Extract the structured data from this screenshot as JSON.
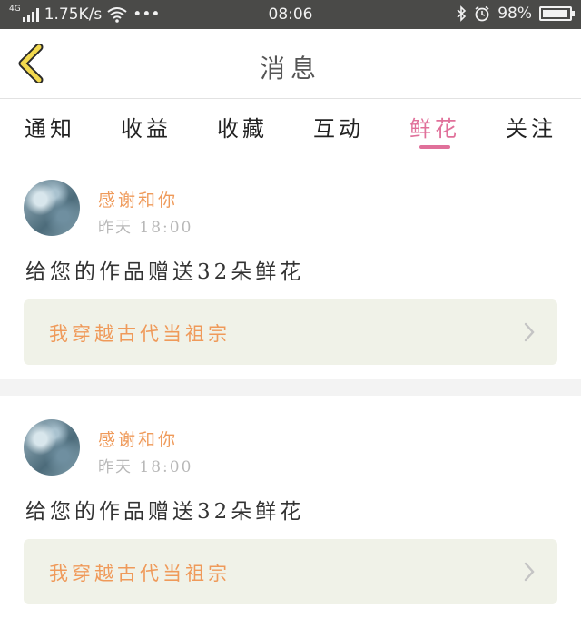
{
  "status_bar": {
    "network_type": "4G",
    "speed": "1.75K/s",
    "dots": "•••",
    "time": "08:06",
    "battery_percent": "98%",
    "battery_level": 0.98,
    "icons": [
      "signal-icon",
      "wifi-icon",
      "bluetooth-icon",
      "alarm-icon",
      "battery-icon"
    ]
  },
  "header": {
    "title": "消息",
    "back_icon": "chevron-left-icon",
    "back_icon_color": "#f2d94e"
  },
  "tabs": [
    {
      "label": "通知",
      "active": false
    },
    {
      "label": "收益",
      "active": false
    },
    {
      "label": "收藏",
      "active": false
    },
    {
      "label": "互动",
      "active": false
    },
    {
      "label": "鲜花",
      "active": true
    },
    {
      "label": "关注",
      "active": false
    }
  ],
  "colors": {
    "accent": "#e0709a",
    "sender": "#ef9a5a",
    "card_link_bg": "#f0f2e8"
  },
  "messages": [
    {
      "sender": "感谢和你",
      "time": "昨天 18:00",
      "text": "给您的作品赠送32朵鲜花",
      "work_title": "我穿越古代当祖宗"
    },
    {
      "sender": "感谢和你",
      "time": "昨天 18:00",
      "text": "给您的作品赠送32朵鲜花",
      "work_title": "我穿越古代当祖宗"
    }
  ]
}
